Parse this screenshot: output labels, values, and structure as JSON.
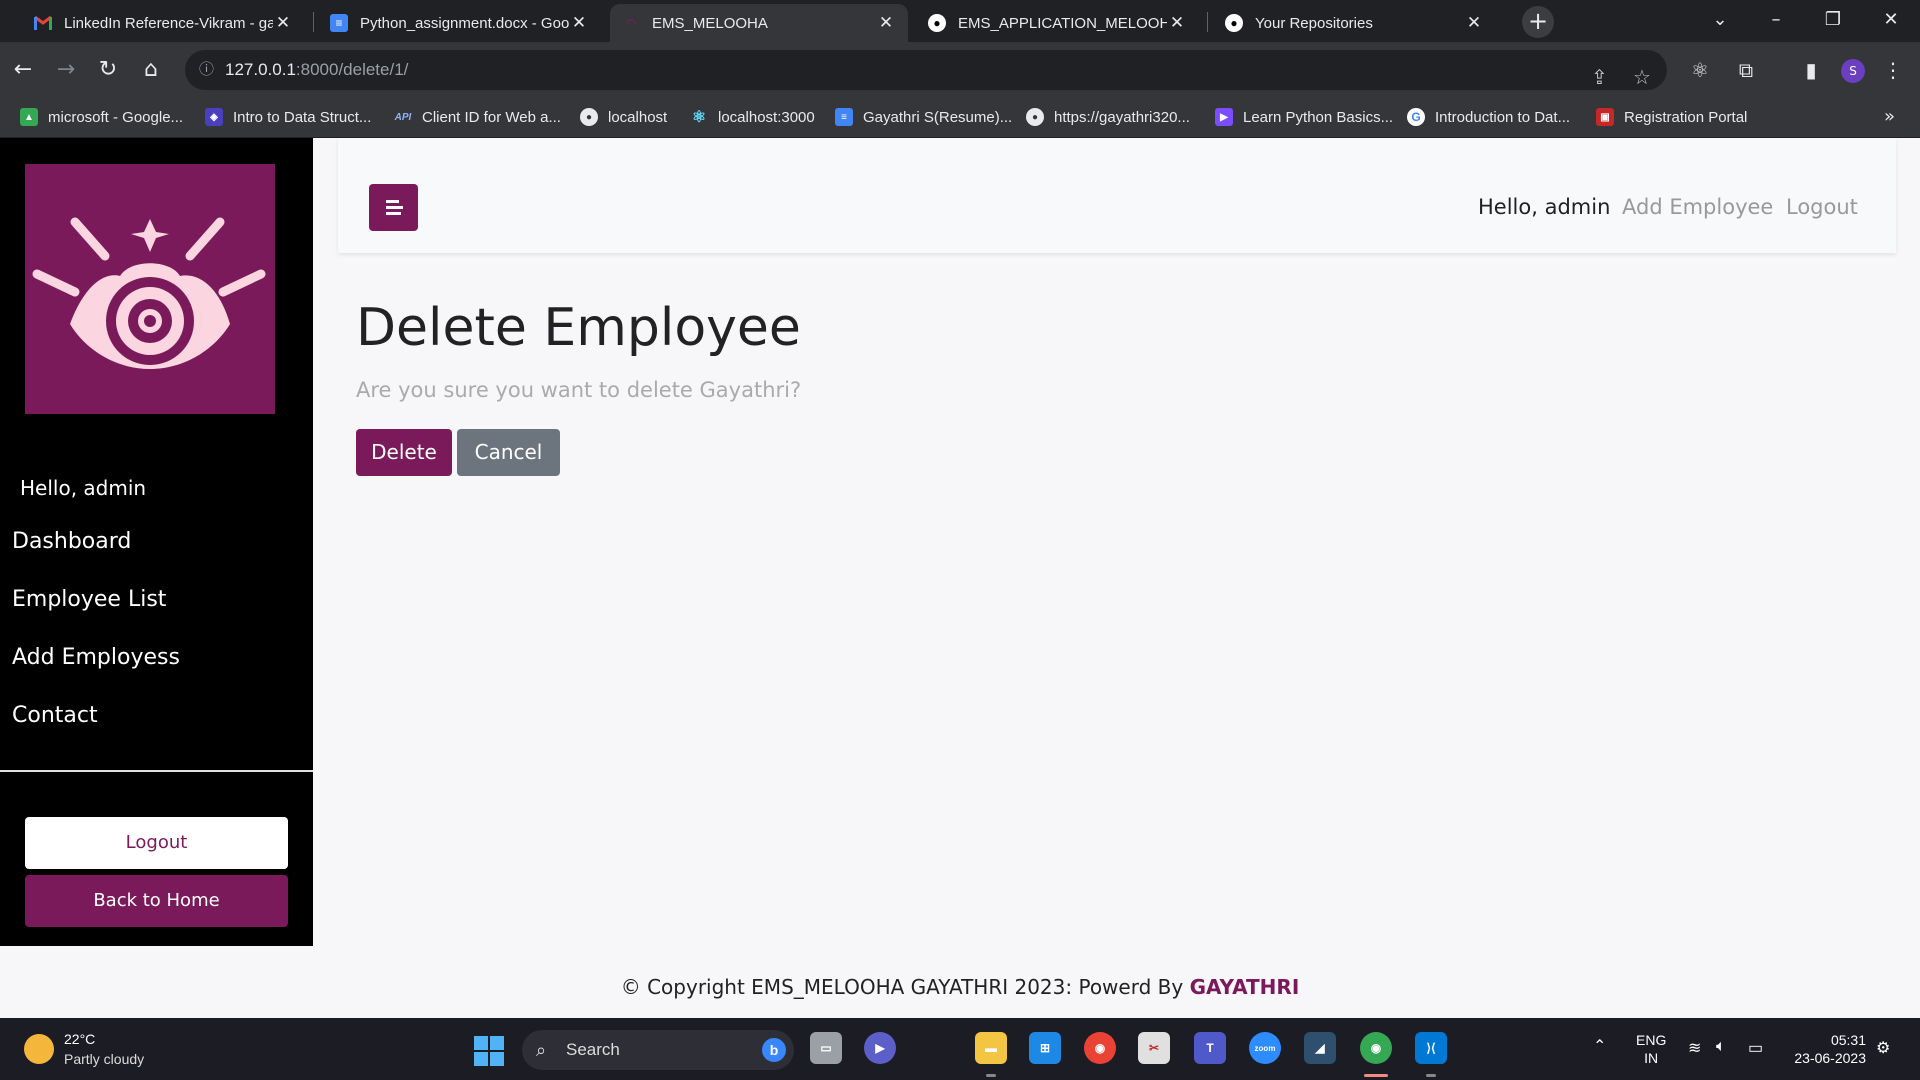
{
  "browser": {
    "tabs": [
      {
        "title": "LinkedIn Reference-Vikram - ga",
        "favicon": "gmail-icon",
        "active": false
      },
      {
        "title": "Python_assignment.docx - Goo",
        "favicon": "docs-icon",
        "active": false
      },
      {
        "title": "EMS_MELOOHA",
        "favicon": "site-icon",
        "active": true
      },
      {
        "title": "EMS_APPLICATION_MELOOHA/",
        "favicon": "github-icon",
        "active": false
      },
      {
        "title": "Your Repositories",
        "favicon": "github-icon",
        "active": false
      }
    ],
    "address": {
      "host": "127.0.0.1",
      "path": ":8000/delete/1/"
    },
    "profile_initial": "S",
    "bookmarks": [
      {
        "label": "microsoft - Google...",
        "icon": "drive-icon",
        "color": "#34a853"
      },
      {
        "label": "Intro to Data Struct...",
        "icon": "course-icon",
        "color": "#4a3fbf"
      },
      {
        "label": "Client ID for Web a...",
        "icon": "api-icon",
        "color": "#8ab4f8"
      },
      {
        "label": "localhost",
        "icon": "globe-icon",
        "color": "#5f6368"
      },
      {
        "label": "localhost:3000",
        "icon": "react-icon",
        "color": "#61dafb"
      },
      {
        "label": "Gayathri S(Resume)...",
        "icon": "docs-icon",
        "color": "#4285f4"
      },
      {
        "label": "https://gayathri320...",
        "icon": "globe-icon",
        "color": "#5f6368"
      },
      {
        "label": "Learn Python Basics...",
        "icon": "play-icon",
        "color": "#7c4dff"
      },
      {
        "label": "Introduction to Dat...",
        "icon": "google-icon",
        "color": "#ffffff"
      },
      {
        "label": "Registration Portal",
        "icon": "portal-icon",
        "color": "#c62828"
      }
    ]
  },
  "sidebar": {
    "greeting": "Hello, admin",
    "links": [
      "Dashboard",
      "Employee List",
      "Add Employess",
      "Contact"
    ],
    "logout_label": "Logout",
    "home_label": "Back to Home"
  },
  "topnav": {
    "greeting": "Hello, admin",
    "add_label": "Add Employee",
    "logout_label": "Logout"
  },
  "content": {
    "title": "Delete Employee",
    "message": "Are you sure you want to delete Gayathri?",
    "delete_label": "Delete",
    "cancel_label": "Cancel"
  },
  "footer": {
    "text": "© Copyright EMS_MELOOHA GAYATHRI 2023: Powerd By ",
    "brand": "GAYATHRI"
  },
  "colors": {
    "accent": "#7b1a5a",
    "sidebar": "#000000",
    "cancel": "#6c757d"
  },
  "taskbar": {
    "temp": "22°C",
    "weather": "Partly cloudy",
    "search_placeholder": "Search",
    "lang_line1": "ENG",
    "lang_line2": "IN",
    "time": "05:31",
    "date": "23-06-2023"
  }
}
